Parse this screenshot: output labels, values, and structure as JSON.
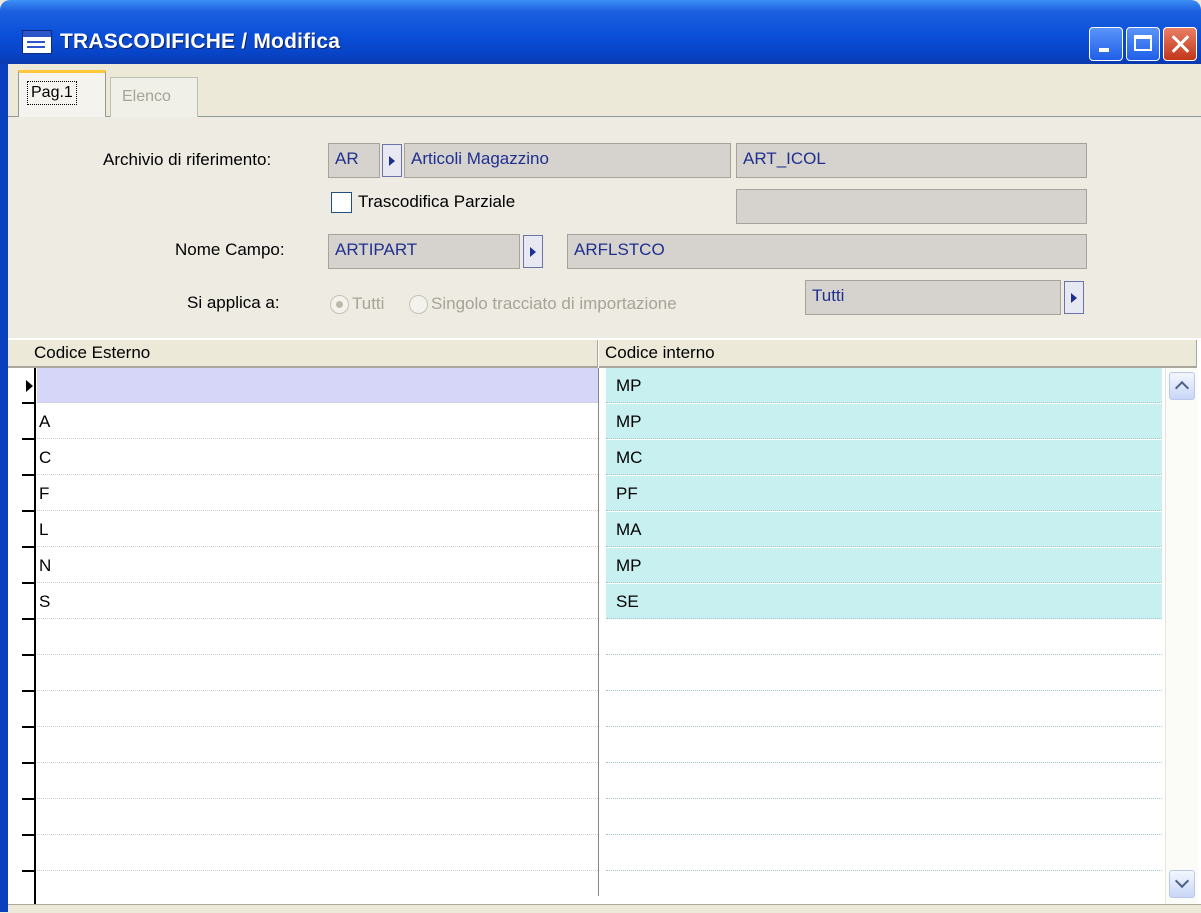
{
  "window": {
    "title": "TRASCODIFICHE / Modifica"
  },
  "tabs": [
    {
      "label": "Pag.1"
    },
    {
      "label": "Elenco"
    }
  ],
  "form": {
    "archivio_label": "Archivio di riferimento:",
    "archivio_code": "AR",
    "archivio_desc": "Articoli Magazzino",
    "archivio_table": "ART_ICOL",
    "parziale_label": "Trascodifica Parziale",
    "parziale_checked": false,
    "nome_campo_label": "Nome Campo:",
    "nome_campo": "ARTIPART",
    "nome_campo_dest": "ARFLSTCO",
    "si_applica_label": "Si applica a:",
    "radio_tutti": "Tutti",
    "radio_singolo": "Singolo tracciato di importazione",
    "applica_value": "Tutti"
  },
  "grid": {
    "columns": [
      "Codice Esterno",
      "Codice interno"
    ],
    "rows": [
      {
        "esterno": "",
        "interno": "MP"
      },
      {
        "esterno": "A",
        "interno": "MP"
      },
      {
        "esterno": "C",
        "interno": "MC"
      },
      {
        "esterno": "F",
        "interno": "PF"
      },
      {
        "esterno": "L",
        "interno": "MA"
      },
      {
        "esterno": "N",
        "interno": "MP"
      },
      {
        "esterno": "S",
        "interno": "SE"
      },
      {
        "esterno": "",
        "interno": ""
      },
      {
        "esterno": "",
        "interno": ""
      },
      {
        "esterno": "",
        "interno": ""
      },
      {
        "esterno": "",
        "interno": ""
      },
      {
        "esterno": "",
        "interno": ""
      },
      {
        "esterno": "",
        "interno": ""
      },
      {
        "esterno": "",
        "interno": ""
      },
      {
        "esterno": "",
        "interno": ""
      }
    ]
  },
  "colors": {
    "titlebar": "#0A4FD8",
    "grid_interno_fill": "#C8F0F0",
    "current_row": "#D6D6F8",
    "field_text": "#1F2F8F"
  }
}
